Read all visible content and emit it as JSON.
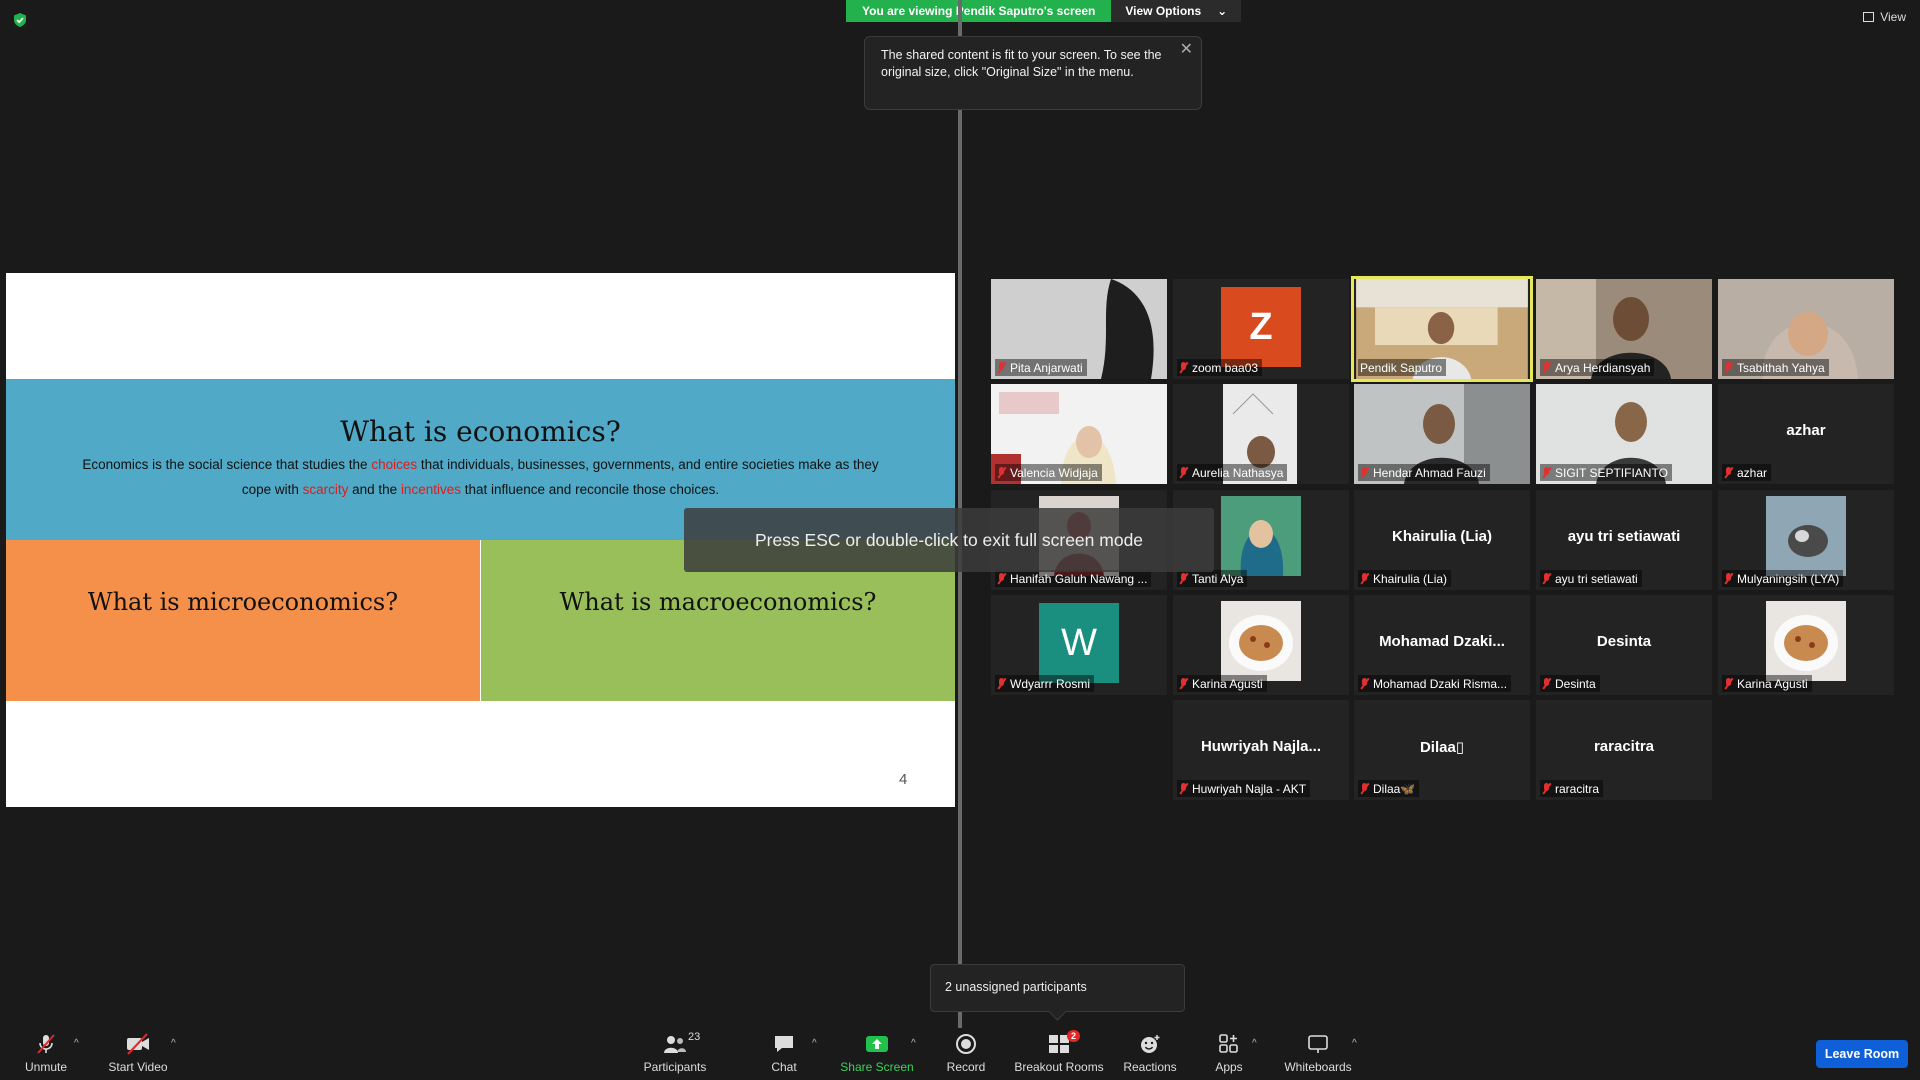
{
  "banner": {
    "viewing_text": "You are viewing Pendik Saputro's screen",
    "view_options_label": "View Options",
    "view_label": "View"
  },
  "tooltip": {
    "text": "The shared content is fit to your screen. To see the original size, click \"Original Size\" in the menu."
  },
  "fullscreen_message": "Press ESC or double-click to exit full screen mode",
  "slide": {
    "title": "What is economics?",
    "body_1": "Economics is the social science that studies the ",
    "kw_choices": "choices",
    "body_2": " that individuals, businesses, governments, and entire societies make as they cope with ",
    "kw_scarcity": "scarcity",
    "body_3": " and the ",
    "kw_incentives": "incentives",
    "body_4": " that influence and reconcile those choices.",
    "micro": "What is microeconomics?",
    "macro": "What is macroeconomics?",
    "page_number": "4"
  },
  "participants": {
    "pita": "Pita Anjarwati",
    "zoom": "zoom baa03",
    "zoom_initial": "Z",
    "pendik": "Pendik Saputro",
    "arya": "Arya Herdiansyah",
    "tsabithah": "Tsabithah Yahya",
    "valencia": "Valencia Widjaja",
    "aurelia": "Aurelia Nathasya",
    "hendar": "Hendar Ahmad Fauzi",
    "sigit": "SIGIT SEPTIFIANTO",
    "azhar": "azhar",
    "azhar_big": "azhar",
    "hanifah": "Hanifah Galuh Nawang ...",
    "tanti": "Tanti Alya",
    "khairulia": "Khairulia (Lia)",
    "khairulia_big": "Khairulia (Lia)",
    "ayu": "ayu tri setiawati",
    "ayu_big": "ayu tri setiawati",
    "mulyaningsih": "Mulyaningsih (LYA)",
    "wdyarrr": "Wdyarrr Rosmi",
    "wdyarrr_initial": "W",
    "karina1": "Karina Agusti",
    "mohamad": "Mohamad Dzaki Risma...",
    "mohamad_big": "Mohamad  Dzaki...",
    "desinta": "Desinta",
    "desinta_big": "Desinta",
    "karina2": "Karina Agusti",
    "huwriyah": "Huwriyah Najla - AKT",
    "huwriyah_big": "Huwriyah  Najla...",
    "dilaa": "Dilaa🦋",
    "dilaa_big": "Dilaa▯",
    "raracitra": "raracitra",
    "raracitra_big": "raracitra"
  },
  "unassigned_text": "2 unassigned participants",
  "toolbar": {
    "unmute": "Unmute",
    "start_video": "Start Video",
    "participants": "Participants",
    "participants_count": "23",
    "chat": "Chat",
    "share_screen": "Share Screen",
    "record": "Record",
    "breakout_rooms": "Breakout Rooms",
    "breakout_badge": "2",
    "reactions": "Reactions",
    "apps": "Apps",
    "whiteboards": "Whiteboards",
    "leave_room": "Leave Room"
  },
  "colors": {
    "share_green": "#22b14c",
    "mute_red": "#e03030",
    "leave_blue": "#0e5fd8",
    "active_speaker": "#e6e85a",
    "slide_blue": "#4fa9c7",
    "slide_orange": "#f5904b",
    "slide_green": "#99bf5a",
    "zoom_avatar": "#d94a1e",
    "w_avatar": "#1b8f7f"
  }
}
